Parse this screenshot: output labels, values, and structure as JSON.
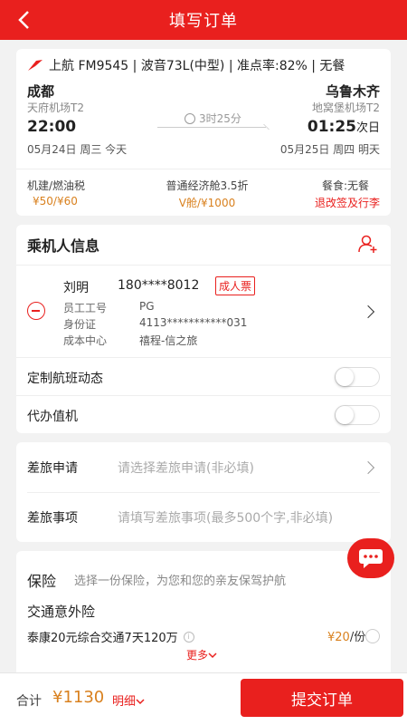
{
  "header": {
    "title": "填写订单"
  },
  "flight": {
    "summary": "上航 FM9545 | 波音73L(中型) | 准点率:82% | 无餐",
    "depart": {
      "city": "成都",
      "airport": "天府机场T2",
      "time": "22:00",
      "date": "05月24日 周三 今天"
    },
    "arrive": {
      "city": "乌鲁木齐",
      "airport": "地窝堡机场T2",
      "time": "01:25",
      "time_suffix": "次日",
      "date": "05月25日 周四 明天"
    },
    "duration": "3时25分",
    "fees": {
      "tax_label": "机建/燃油税",
      "tax_value": "¥50/¥60",
      "cabin_label": "普通经济舱3.5折",
      "cabin_value": "V舱/¥1000",
      "meal_label": "餐食:无餐",
      "policy_link": "退改签及行李"
    }
  },
  "passenger": {
    "section_title": "乘机人信息",
    "name": "刘明",
    "phone": "180****8012",
    "ticket_type": "成人票",
    "fields": [
      {
        "label": "员工工号",
        "value": "PG"
      },
      {
        "label": "身份证",
        "value": "4113***********031"
      },
      {
        "label": "成本中心",
        "value": "禧程-信之旅"
      }
    ],
    "toggles": [
      {
        "label": "定制航班动态",
        "on": false
      },
      {
        "label": "代办值机",
        "on": false
      }
    ]
  },
  "trip": {
    "application_label": "差旅申请",
    "application_placeholder": "请选择差旅申请(非必填)",
    "matter_label": "差旅事项",
    "matter_placeholder": "请填写差旅事项(最多500个字,非必填)"
  },
  "insurance": {
    "title": "保险",
    "subtitle": "选择一份保险，为您和您的亲友保驾护航",
    "type": "交通意外险",
    "product": "泰康20元综合交通7天120万",
    "price": "¥20",
    "price_unit": "/份",
    "more": "更多"
  },
  "footer": {
    "total_label": "合计",
    "total_value": "¥1130",
    "detail_label": "明细",
    "submit_label": "提交订单"
  },
  "colors": {
    "primary": "#e9201e",
    "price": "#d9811f"
  }
}
